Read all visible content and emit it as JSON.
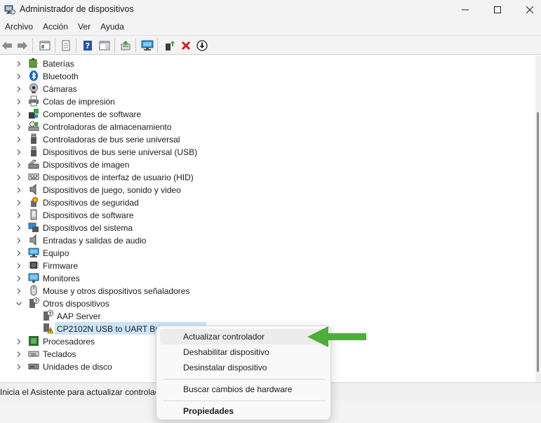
{
  "window": {
    "title": "Administrador de dispositivos"
  },
  "menu": [
    "Archivo",
    "Acción",
    "Ver",
    "Ayuda"
  ],
  "tree": [
    {
      "label": "Baterías",
      "icon": "battery-icon",
      "expanded": false
    },
    {
      "label": "Bluetooth",
      "icon": "bluetooth-icon",
      "expanded": false
    },
    {
      "label": "Cámaras",
      "icon": "camera-icon",
      "expanded": false
    },
    {
      "label": "Colas de impresión",
      "icon": "printer-icon",
      "expanded": false
    },
    {
      "label": "Componentes de software",
      "icon": "software-component-icon",
      "expanded": false
    },
    {
      "label": "Controladoras de almacenamiento",
      "icon": "storage-controller-icon",
      "expanded": false
    },
    {
      "label": "Controladoras de bus serie universal",
      "icon": "usb-icon",
      "expanded": false
    },
    {
      "label": "Dispositivos de bus serie universal (USB)",
      "icon": "usb-icon",
      "expanded": false
    },
    {
      "label": "Dispositivos de imagen",
      "icon": "scanner-icon",
      "expanded": false
    },
    {
      "label": "Dispositivos de interfaz de usuario (HID)",
      "icon": "keyboard-hid-icon",
      "expanded": false
    },
    {
      "label": "Dispositivos de juego, sonido y video",
      "icon": "speaker-icon",
      "expanded": false
    },
    {
      "label": "Dispositivos de seguridad",
      "icon": "security-key-icon",
      "expanded": false
    },
    {
      "label": "Dispositivos de software",
      "icon": "software-device-icon",
      "expanded": false
    },
    {
      "label": "Dispositivos del sistema",
      "icon": "system-device-icon",
      "expanded": false
    },
    {
      "label": "Entradas y salidas de audio",
      "icon": "audio-io-icon",
      "expanded": false
    },
    {
      "label": "Equipo",
      "icon": "computer-icon",
      "expanded": false
    },
    {
      "label": "Firmware",
      "icon": "chip-icon",
      "expanded": false
    },
    {
      "label": "Monitores",
      "icon": "monitor-icon",
      "expanded": false
    },
    {
      "label": "Mouse y otros dispositivos señaladores",
      "icon": "mouse-icon",
      "expanded": false
    },
    {
      "label": "Otros dispositivos",
      "icon": "unknown-device-icon",
      "expanded": true,
      "children": [
        {
          "label": "AAP Server",
          "icon": "unknown-device-icon"
        },
        {
          "label": "CP2102N USB to UART Bridge Controller",
          "icon": "warning-device-icon",
          "selected": true
        }
      ]
    },
    {
      "label": "Procesadores",
      "icon": "processor-icon",
      "expanded": false
    },
    {
      "label": "Teclados",
      "icon": "keyboard-icon",
      "expanded": false
    },
    {
      "label": "Unidades de disco",
      "icon": "disk-drive-icon",
      "expanded": false
    }
  ],
  "status": {
    "text": "Inicia el Asistente para actualizar controlad"
  },
  "context_menu": {
    "update": "Actualizar controlador",
    "disable": "Deshabilitar dispositivo",
    "uninstall": "Desinstalar dispositivo",
    "scan": "Buscar cambios de hardware",
    "properties": "Propiedades"
  },
  "colors": {
    "selection": "#cce4f7",
    "arrow": "#4caf3a",
    "remove": "#e0161c",
    "help": "#2455a8"
  }
}
